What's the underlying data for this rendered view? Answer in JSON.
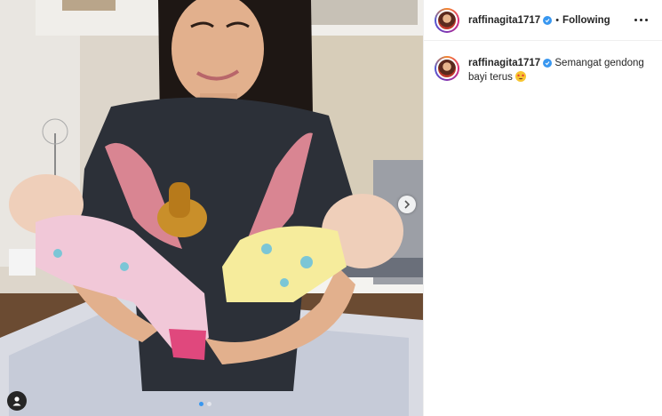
{
  "post": {
    "username": "raffinagita1717",
    "separator": "•",
    "follow_status": "Following",
    "caption_text": "Semangat gendong bayi terus",
    "caption_emoji": "star-struck-emoji",
    "carousel_dots": 2,
    "active_dot": 1
  },
  "icons": {
    "verified": "verified-badge-icon",
    "more": "more-options-icon",
    "next": "chevron-right-icon",
    "tag": "user-tag-icon"
  },
  "colors": {
    "verified_blue": "#3897f0",
    "text": "#262626",
    "border": "#efefef"
  }
}
